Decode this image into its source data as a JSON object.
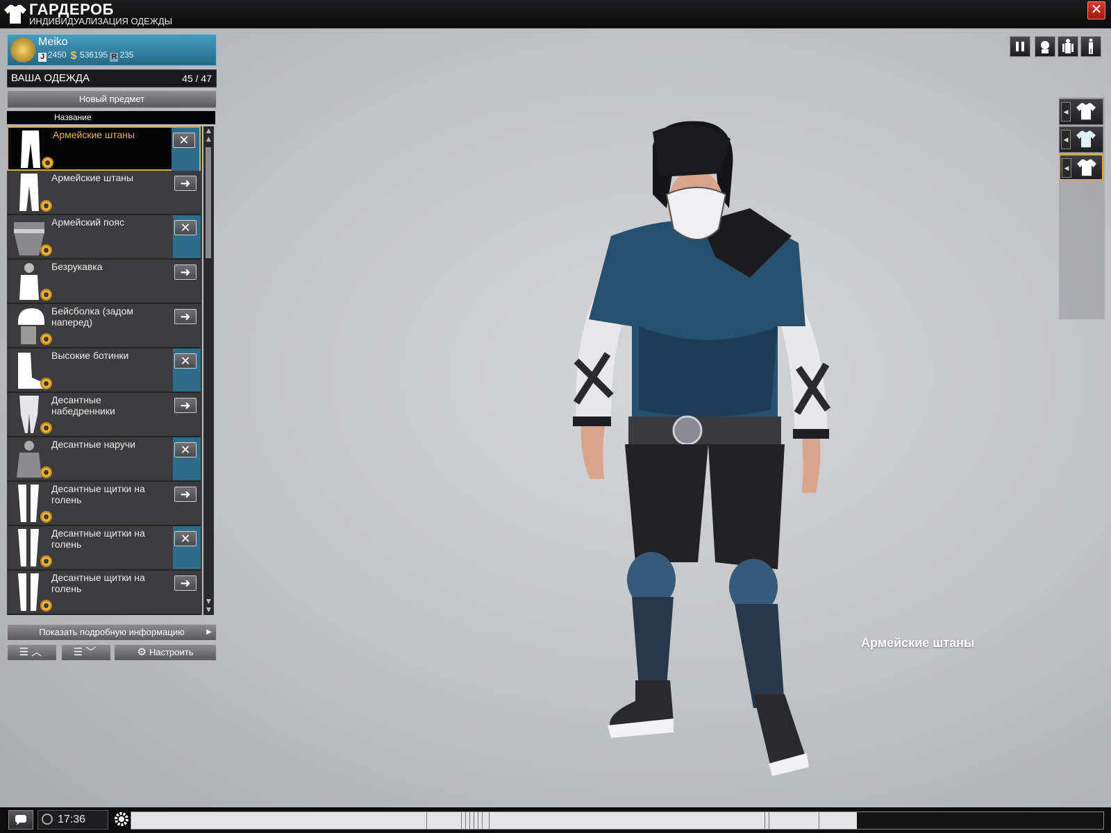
{
  "header": {
    "title": "ГАРДЕРОБ",
    "subtitle": "ИНДИВИДУАЛИЗАЦИЯ ОДЕЖДЫ",
    "close_label": "✕"
  },
  "profile": {
    "name": "Meiko",
    "stat_j": "2450",
    "stat_money": "536195",
    "stat_r": "235"
  },
  "wardrobe": {
    "label": "ВАША ОДЕЖДА",
    "count": "45 / 47",
    "new_item_label": "Новый предмет",
    "column_name": "Название",
    "items": [
      {
        "name": "Армейские штаны",
        "icon": "pants-icon",
        "action": "remove",
        "worn": true,
        "selected": true
      },
      {
        "name": "Армейские штаны",
        "icon": "pants-icon",
        "action": "equip",
        "worn": false,
        "selected": false
      },
      {
        "name": "Армейский пояс",
        "icon": "belt-icon",
        "action": "remove",
        "worn": true,
        "selected": false
      },
      {
        "name": "Безрукавка",
        "icon": "tanktop-icon",
        "action": "equip",
        "worn": false,
        "selected": false
      },
      {
        "name": "Бейсболка (задом наперед)",
        "icon": "cap-icon",
        "action": "equip",
        "worn": false,
        "selected": false
      },
      {
        "name": "Высокие ботинки",
        "icon": "boots-icon",
        "action": "remove",
        "worn": true,
        "selected": false
      },
      {
        "name": "Десантные набедренники",
        "icon": "thigh-guards-icon",
        "action": "equip",
        "worn": false,
        "selected": false
      },
      {
        "name": "Десантные наручи",
        "icon": "bracers-icon",
        "action": "remove",
        "worn": true,
        "selected": false
      },
      {
        "name": "Десантные щитки на голень",
        "icon": "shin-guards-icon",
        "action": "equip",
        "worn": false,
        "selected": false
      },
      {
        "name": "Десантные щитки на голень",
        "icon": "shin-guards-icon",
        "action": "remove",
        "worn": true,
        "selected": false
      },
      {
        "name": "Десантные щитки на голень",
        "icon": "shin-guards-icon",
        "action": "equip",
        "worn": false,
        "selected": false
      }
    ],
    "details_label": "Показать подробную информацию",
    "customize_label": "Настроить"
  },
  "preview": {
    "caption": "Армейские штаны"
  },
  "footer": {
    "time": "17:36"
  },
  "colors": {
    "accent_gold": "#d6a84c",
    "worn_blue": "#2e6c8a",
    "profile_blue": "#3a86a8"
  }
}
